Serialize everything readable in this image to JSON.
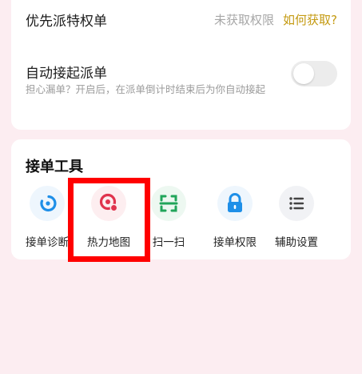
{
  "priority": {
    "label": "优先派特权单",
    "status": "未获取权限",
    "how_link": "如何获取?"
  },
  "auto_accept": {
    "label": "自动接起派单",
    "description": "担心漏单？开启后，在派单倒计时结束后为你自动接起",
    "toggle_on": false
  },
  "tools": {
    "title": "接单工具",
    "items": [
      {
        "label": "接单诊断",
        "icon": "diagnose-icon",
        "color": "#1e8fe8"
      },
      {
        "label": "热力地图",
        "icon": "heatmap-pin-icon",
        "color": "#e0334d"
      },
      {
        "label": "扫一扫",
        "icon": "scan-icon",
        "color": "#21a55a"
      },
      {
        "label": "接单权限",
        "icon": "lock-icon",
        "color": "#1e8fe8"
      },
      {
        "label": "辅助设置",
        "icon": "list-icon",
        "color": "#444444"
      }
    ]
  },
  "colors": {
    "background": "#fcedf1",
    "highlight": "#ff0000",
    "link": "#c49a11"
  }
}
